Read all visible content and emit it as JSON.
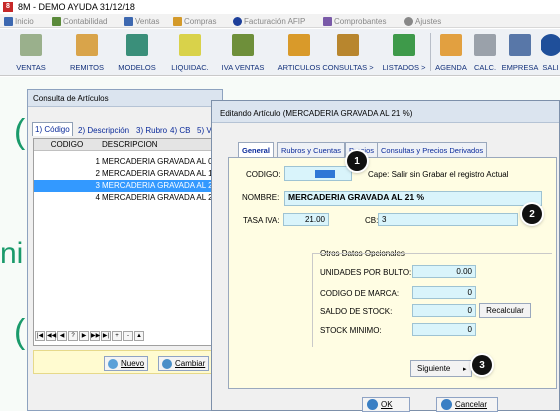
{
  "window": {
    "title": "8M - DEMO AYUDA 31/12/18"
  },
  "menu": [
    {
      "label": "Inicio",
      "color": "#3d68b0"
    },
    {
      "label": "Contabilidad",
      "color": "#5a8a3a"
    },
    {
      "label": "Ventas",
      "color": "#3d68b0"
    },
    {
      "label": "Compras",
      "color": "#d49a2a"
    },
    {
      "label": "Facturación AFIP",
      "color": "#1d3f9a"
    },
    {
      "label": "Comprobantes",
      "color": "#7a5aa8"
    },
    {
      "label": "Ajustes",
      "color": "#888888"
    }
  ],
  "toolbar": {
    "ventas": "VENTAS",
    "remitos": "REMITOS",
    "modelos": "MODELOS",
    "liquidac": "LIQUIDAC.",
    "iva_ventas": "IVA VENTAS",
    "articulos": "ARTICULOS",
    "consultas": "CONSULTAS >",
    "listados": "LISTADOS >",
    "agenda": "AGENDA",
    "calc": "CALC.",
    "empresa": "EMPRESA",
    "salir": "SALI"
  },
  "background": {
    "glyph_letter": "ni"
  },
  "consulta": {
    "title": "Consulta de Artículos",
    "tabs": [
      "1) Código",
      "2) Descripción",
      "3) Rubro",
      "4) CB",
      "5) V"
    ],
    "columns": [
      "CODIGO",
      "DESCRIPCION"
    ],
    "rows": [
      {
        "codigo": "1",
        "descripcion": "MERCADERIA GRAVADA AL 0"
      },
      {
        "codigo": "2",
        "descripcion": "MERCADERIA GRAVADA AL 1"
      },
      {
        "codigo": "3",
        "descripcion": "MERCADERIA GRAVADA AL 2"
      },
      {
        "codigo": "4",
        "descripcion": "MERCADERIA GRAVADA AL 2"
      }
    ],
    "selected_row_index": 2,
    "nav_buttons": [
      "|◀",
      "◀◀",
      "◀",
      "?",
      "▶",
      "▶▶",
      "▶|",
      "+",
      "-",
      "▲"
    ],
    "buttons": {
      "nuevo": "Nuevo",
      "cambiar": "Cambiar"
    }
  },
  "edit": {
    "title": "Editando Artículo  (MERCADERIA GRAVADA AL 21 %)",
    "tabs": [
      "General",
      "Rubros y Cuentas",
      "Precios",
      "Consultas y Precios Derivados"
    ],
    "active_tab": "General",
    "codigo_label": "CODIGO:",
    "codigo_value": "",
    "esc_hint": "Cape: Salir sin Grabar el registro Actual",
    "nombre_label": "NOMBRE:",
    "nombre_value": "MERCADERIA GRAVADA AL 21 %",
    "tasa_label": "TASA IVA:",
    "tasa_value": "21.00",
    "cb_label": "CB:",
    "cb_value": "3",
    "opcionales_title": "Otros Datos Opcionales",
    "unidades_label": "UNIDADES POR BULTO:",
    "unidades_value": "0.00",
    "marca_label": "CODIGO DE MARCA:",
    "marca_value": "0",
    "stock_label": "SALDO DE STOCK:",
    "stock_value": "0",
    "recalcular": "Recalcular",
    "minimo_label": "STOCK MINIMO:",
    "minimo_value": "0",
    "siguiente": "Siguiente",
    "ok": "OK",
    "cancelar": "Cancelar"
  },
  "callouts": [
    "1",
    "2",
    "3"
  ]
}
